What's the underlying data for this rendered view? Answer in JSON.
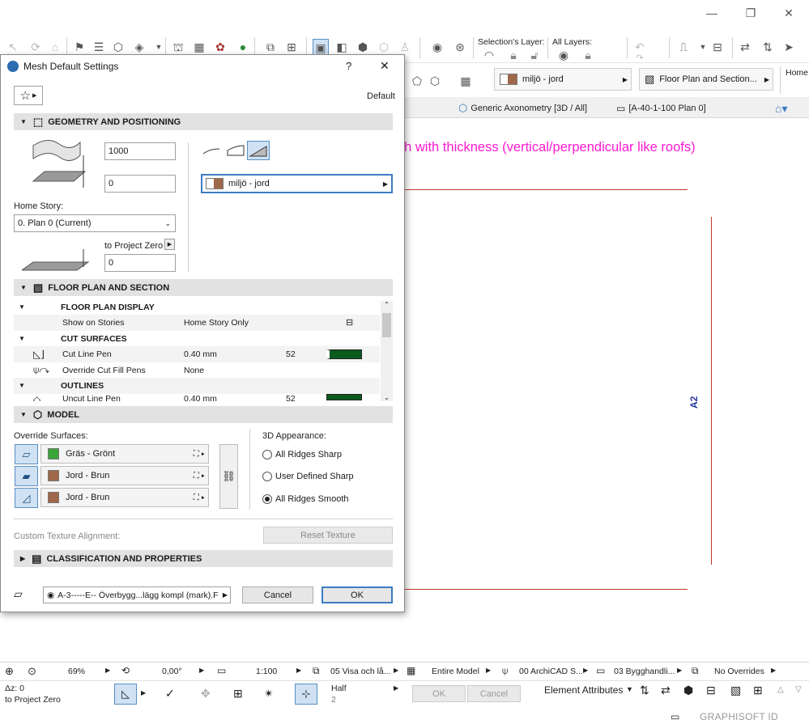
{
  "toolbar": {
    "selection_layer_label": "Selection's Layer:",
    "all_layers_label": "All Layers:",
    "home_label": "Home"
  },
  "toolbar2": {
    "material": "miljö - jord",
    "view_name": "Floor Plan and Section..."
  },
  "tabs": {
    "tab1": "Generic Axonometry [3D / All]",
    "tab2": "[A-40-1-100 Plan 0]"
  },
  "canvas": {
    "marker": "A2"
  },
  "annotation": "New type: Mesh with thickness (vertical/perpendicular like roofs)",
  "dialog": {
    "title": "Mesh Default Settings",
    "help": "?",
    "close": "✕",
    "favorite_state": "Default",
    "geometry": {
      "heading": "GEOMETRY AND POSITIONING",
      "height_value": "1000",
      "offset_value": "0",
      "home_story_label": "Home Story:",
      "home_story_value": "0. Plan 0 (Current)",
      "to_project_zero_label": "to Project Zero",
      "project_zero_value": "0",
      "material": "miljö - jord"
    },
    "floor_plan": {
      "heading": "FLOOR PLAN AND SECTION",
      "subheading_display": "FLOOR PLAN DISPLAY",
      "show_on_stories_label": "Show on Stories",
      "show_on_stories_value": "Home Story Only",
      "subheading_cut": "CUT SURFACES",
      "cut_line_pen_label": "Cut Line Pen",
      "cut_line_pen_value": "0.40 mm",
      "cut_line_pen_num": "52",
      "override_cut_label": "Override Cut Fill Pens",
      "override_cut_value": "None",
      "subheading_outlines": "OUTLINES",
      "uncut_line_pen_label": "Uncut Line Pen",
      "uncut_line_pen_value": "0.40 mm",
      "uncut_line_pen_num": "52"
    },
    "model": {
      "heading": "MODEL",
      "override_surfaces_label": "Override Surfaces:",
      "surfaces": [
        {
          "name": "Gräs - Grönt",
          "color": "#3aa63a"
        },
        {
          "name": "Jord - Brun",
          "color": "#a0684a"
        },
        {
          "name": "Jord - Brun",
          "color": "#a0684a"
        }
      ],
      "appearance_label": "3D Appearance:",
      "options": [
        "All Ridges Sharp",
        "User Defined Sharp",
        "All Ridges Smooth"
      ],
      "selected_option": "All Ridges Smooth",
      "texture_alignment_label": "Custom Texture Alignment:",
      "reset_texture": "Reset Texture"
    },
    "classification": {
      "heading": "CLASSIFICATION AND PROPERTIES"
    },
    "footer": {
      "layer": "A-3-----E-- Överbygg...lägg kompl (mark).F",
      "cancel": "Cancel",
      "ok": "OK"
    }
  },
  "statusbar": {
    "zoom": "69%",
    "angle": "0,00°",
    "scale": "1:100",
    "view_1": "05 Visa och lå...",
    "model": "Entire Model",
    "pen_set": "00 ArchiCAD S...",
    "layer_combo": "03 Bygghandli...",
    "overrides": "No Overrides",
    "dz_label": "Δz: 0",
    "to_project_zero": "to Project Zero",
    "half_label": "Half",
    "half_value": "2",
    "ok": "OK",
    "cancel": "Cancel",
    "element_attributes": "Element Attributes",
    "brand": "GRAPHISOFT ID"
  }
}
